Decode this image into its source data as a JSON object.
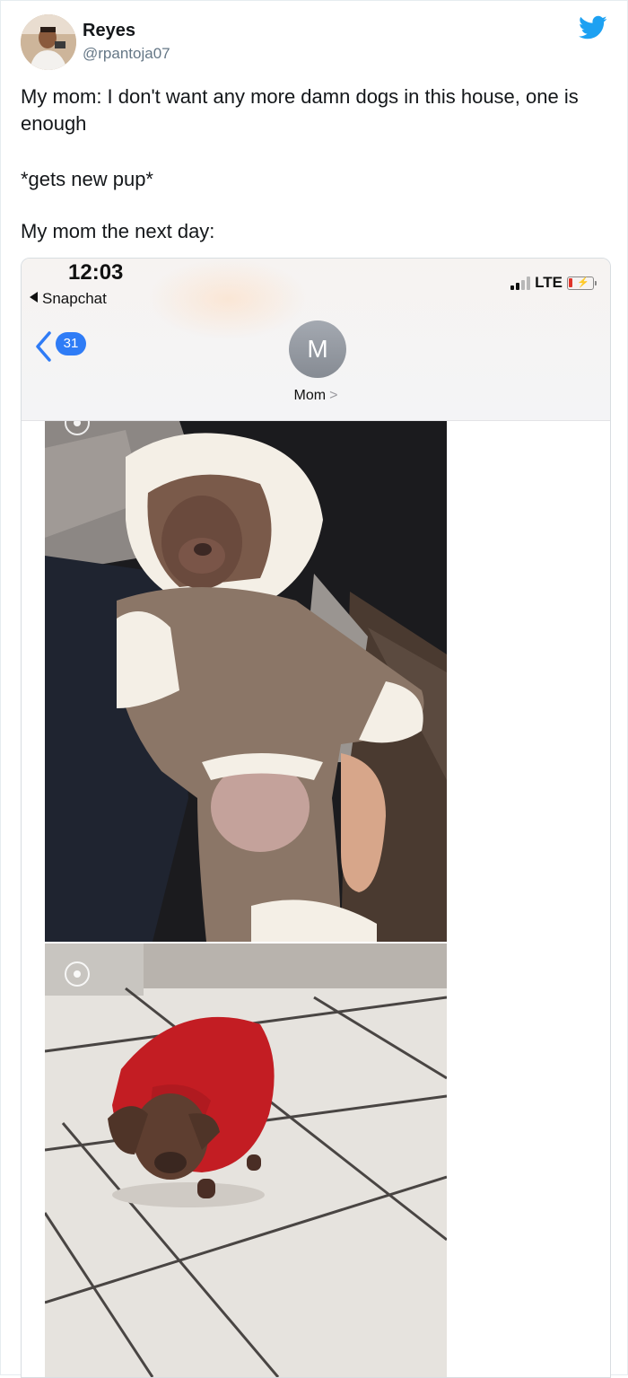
{
  "tweet": {
    "author_name": "Reyes",
    "author_handle": "@rpantoja07",
    "line1": "My mom: I don't want any more damn dogs in this house, one is enough",
    "line2": "*gets new pup*",
    "line3": "My mom the next day:",
    "brand_color": "#1da1f2"
  },
  "phone": {
    "time": "12:03",
    "back_app": "Snapchat",
    "network": "LTE",
    "unread_count": "31",
    "contact_initial": "M",
    "contact_name": "Mom",
    "accent_color": "#2f7cf6",
    "battery_color": "#e0352b"
  },
  "icons": {
    "twitter": "twitter-bird-icon",
    "back": "chevron-left-icon",
    "signal": "signal-bars-icon",
    "battery": "battery-charging-icon",
    "live_photo": "live-photo-icon"
  }
}
